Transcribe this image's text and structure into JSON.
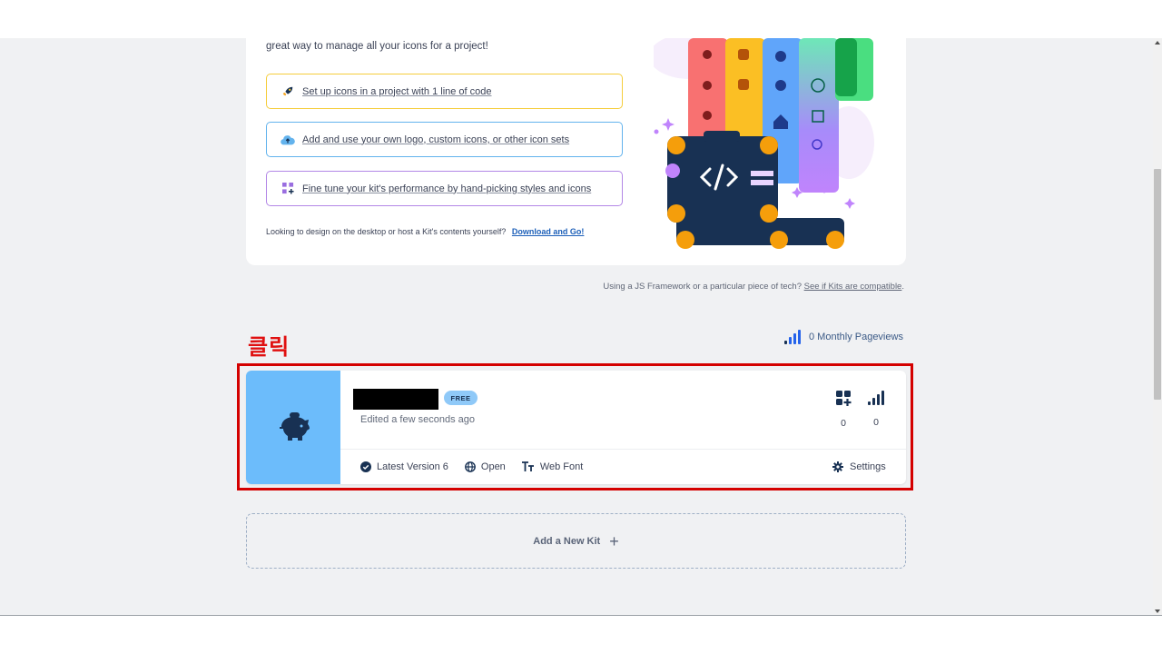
{
  "intro": {
    "text": "great way to manage all your icons for a project!",
    "actions": [
      {
        "label": "Set up icons in a project with 1 line of code",
        "icon": "rocket-icon"
      },
      {
        "label": "Add and use your own logo, custom icons, or other icon sets",
        "icon": "cloud-upload-icon"
      },
      {
        "label": "Fine tune your kit's performance by hand-picking styles and icons",
        "icon": "grid-plus-icon"
      }
    ],
    "desktop_note": "Looking to design on the desktop or host a Kit's contents yourself?",
    "desktop_link": "Download and Go!"
  },
  "compat": {
    "text": "Using a JS Framework or a particular piece of tech?",
    "link": "See if Kits are compatible",
    "suffix": "."
  },
  "annotation": {
    "click_label": "클릭"
  },
  "pageviews": {
    "label": "0 Monthly Pageviews"
  },
  "kit": {
    "badge": "FREE",
    "edited": "Edited a few seconds ago",
    "icons_count": "0",
    "pageviews_count": "0",
    "version": "Latest Version 6",
    "access": "Open",
    "tech": "Web Font",
    "settings": "Settings"
  },
  "add_kit": {
    "label": "Add a New Kit",
    "plus": "+"
  },
  "colors": {
    "accent_blue": "#1c5fb8",
    "kit_thumb": "#6cbcfb",
    "highlight_red": "#d40000",
    "navy": "#183153"
  }
}
